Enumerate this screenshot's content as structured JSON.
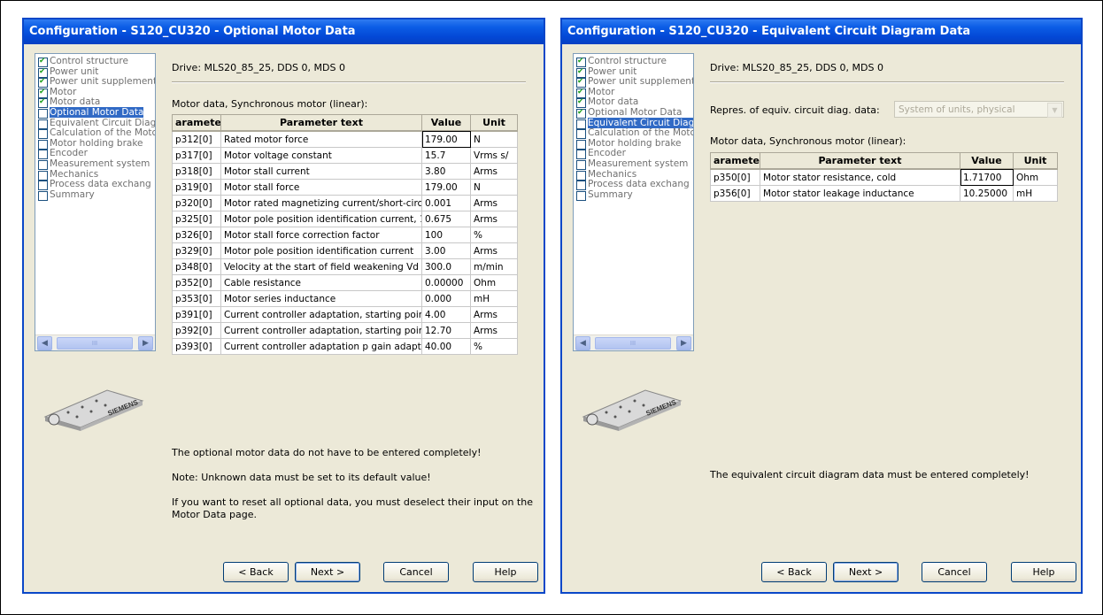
{
  "dialog1": {
    "title": "Configuration - S120_CU320 - Optional Motor Data",
    "drive": "Drive: MLS20_85_25, DDS 0, MDS 0",
    "caption": "Motor data, Synchronous motor (linear):",
    "nav": [
      {
        "label": "Control structure",
        "checked": true
      },
      {
        "label": "Power unit",
        "checked": true
      },
      {
        "label": "Power unit supplement",
        "checked": true
      },
      {
        "label": "Motor",
        "checked": true
      },
      {
        "label": "Motor data",
        "checked": true
      },
      {
        "label": "Optional Motor Data",
        "checked": false,
        "selected": true
      },
      {
        "label": "Equivalent Circuit Diag",
        "checked": false
      },
      {
        "label": "Calculation of the Motc",
        "checked": false
      },
      {
        "label": "Motor holding brake",
        "checked": false
      },
      {
        "label": "Encoder",
        "checked": false
      },
      {
        "label": "Measurement system",
        "checked": false
      },
      {
        "label": "Mechanics",
        "checked": false
      },
      {
        "label": "Process data exchang",
        "checked": false
      },
      {
        "label": "Summary",
        "checked": false
      }
    ],
    "table": {
      "headers": [
        "aramete",
        "Parameter text",
        "Value",
        "Unit"
      ],
      "rows": [
        [
          "p312[0]",
          "Rated motor force",
          "179.00",
          "N"
        ],
        [
          "p317[0]",
          "Motor voltage constant",
          "15.7",
          "Vrms s/"
        ],
        [
          "p318[0]",
          "Motor stall current",
          "3.80",
          "Arms"
        ],
        [
          "p319[0]",
          "Motor stall force",
          "179.00",
          "N"
        ],
        [
          "p320[0]",
          "Motor rated magnetizing current/short-circc",
          "0.001",
          "Arms"
        ],
        [
          "p325[0]",
          "Motor pole position identification current, 1",
          "0.675",
          "Arms"
        ],
        [
          "p326[0]",
          "Motor stall force correction factor",
          "100",
          "%"
        ],
        [
          "p329[0]",
          "Motor pole position identification current",
          "3.00",
          "Arms"
        ],
        [
          "p348[0]",
          "Velocity at the start of field weakening Vd",
          "300.0",
          "m/min"
        ],
        [
          "p352[0]",
          "Cable resistance",
          "0.00000",
          "Ohm"
        ],
        [
          "p353[0]",
          "Motor series inductance",
          "0.000",
          "mH"
        ],
        [
          "p391[0]",
          "Current controller adaptation, starting point",
          "4.00",
          "Arms"
        ],
        [
          "p392[0]",
          "Current controller adaptation, starting point",
          "12.70",
          "Arms"
        ],
        [
          "p393[0]",
          "Current controller adaptation p gain adapts",
          "40.00",
          "%"
        ]
      ]
    },
    "messages": [
      "The optional motor data do not have to be entered completely!",
      "Note: Unknown data must be set to its default value!",
      "If you want to reset all optional data, you must deselect their input on the Motor Data page."
    ],
    "buttons": {
      "back": "< Back",
      "next": "Next >",
      "cancel": "Cancel",
      "help": "Help"
    }
  },
  "dialog2": {
    "title": "Configuration - S120_CU320 - Equivalent Circuit Diagram Data",
    "drive": "Drive: MLS20_85_25, DDS 0, MDS 0",
    "repres_label": "Repres. of equiv. circuit diag. data:",
    "repres_value": "System of units, physical",
    "caption": "Motor data, Synchronous motor (linear):",
    "nav": [
      {
        "label": "Control structure",
        "checked": true
      },
      {
        "label": "Power unit",
        "checked": true
      },
      {
        "label": "Power unit supplement",
        "checked": true
      },
      {
        "label": "Motor",
        "checked": true
      },
      {
        "label": "Motor data",
        "checked": true
      },
      {
        "label": "Optional Motor Data",
        "checked": true
      },
      {
        "label": "Equivalent Circuit Diag",
        "checked": false,
        "selected": true
      },
      {
        "label": "Calculation of the Motc",
        "checked": false
      },
      {
        "label": "Motor holding brake",
        "checked": false
      },
      {
        "label": "Encoder",
        "checked": false
      },
      {
        "label": "Measurement system",
        "checked": false
      },
      {
        "label": "Mechanics",
        "checked": false
      },
      {
        "label": "Process data exchang",
        "checked": false
      },
      {
        "label": "Summary",
        "checked": false
      }
    ],
    "table": {
      "headers": [
        "aramete",
        "Parameter text",
        "Value",
        "Unit"
      ],
      "rows": [
        [
          "p350[0]",
          "Motor stator resistance, cold",
          "1.71700",
          "Ohm"
        ],
        [
          "p356[0]",
          "Motor stator leakage inductance",
          "10.25000",
          "mH"
        ]
      ]
    },
    "messages": [
      "The equivalent circuit diagram data must be entered completely!"
    ],
    "buttons": {
      "back": "< Back",
      "next": "Next >",
      "cancel": "Cancel",
      "help": "Help"
    }
  },
  "icons": {
    "scroll_left": "scroll-left-arrow-icon",
    "scroll_right": "scroll-right-arrow-icon",
    "combo_arrow": "chevron-down-icon"
  },
  "colors": {
    "titlebar": "#0348d6",
    "dialog_bg": "#ece9d8",
    "selection": "#316ac5"
  },
  "brand": "SIEMENS",
  "scroll_thumb": "III",
  "combo_arrow_glyph": "▼"
}
